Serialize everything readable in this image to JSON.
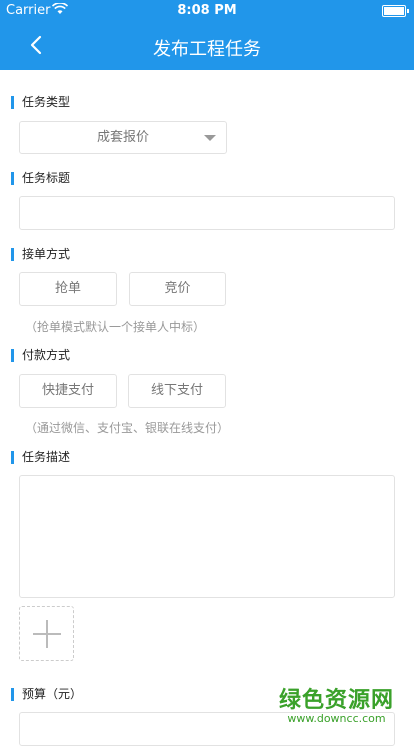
{
  "status": {
    "carrier": "Carrier",
    "time": "8:08 PM"
  },
  "nav": {
    "title": "发布工程任务"
  },
  "task_type": {
    "label": "任务类型",
    "value": "成套报价"
  },
  "task_title": {
    "label": "任务标题",
    "value": ""
  },
  "order_mode": {
    "label": "接单方式",
    "options": [
      "抢单",
      "竞价"
    ],
    "hint": "（抢单模式默认一个接单人中标）"
  },
  "payment": {
    "label": "付款方式",
    "options": [
      "快捷支付",
      "线下支付"
    ],
    "hint": "（通过微信、支付宝、银联在线支付）"
  },
  "description": {
    "label": "任务描述",
    "value": ""
  },
  "budget": {
    "label": "预算（元）"
  },
  "watermark": {
    "main": "绿色资源网",
    "sub": "www.downcc.com"
  },
  "colors": {
    "accent": "#2196ea"
  }
}
